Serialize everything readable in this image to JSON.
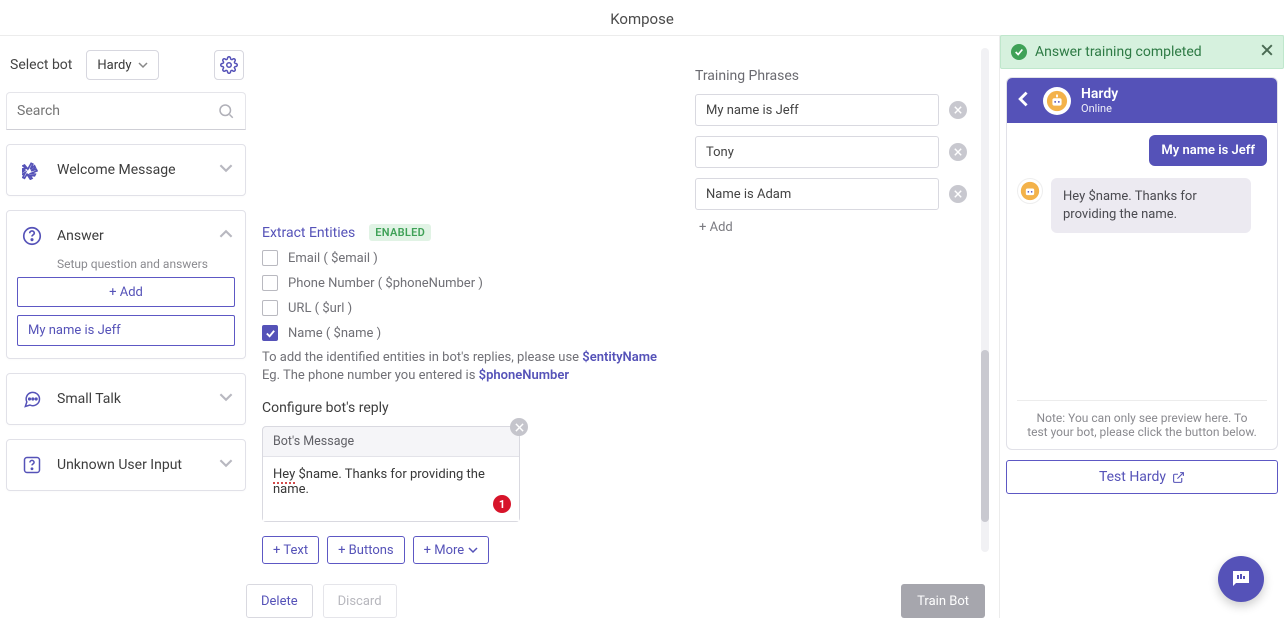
{
  "app_title": "Kompose",
  "sidebar": {
    "select_label": "Select bot",
    "selected_bot": "Hardy",
    "search_placeholder": "Search",
    "intents": {
      "welcome": {
        "title": "Welcome Message"
      },
      "answer": {
        "title": "Answer",
        "subtitle": "Setup question and answers",
        "add_label": "+ Add",
        "items": [
          "My name is Jeff"
        ]
      },
      "smalltalk": {
        "title": "Small Talk"
      },
      "unknown": {
        "title": "Unknown User Input"
      }
    }
  },
  "entities": {
    "section_title": "Extract Entities",
    "badge": "ENABLED",
    "options": [
      {
        "label": "Email ( $email )",
        "checked": false
      },
      {
        "label": "Phone Number ( $phoneNumber )",
        "checked": false
      },
      {
        "label": "URL ( $url )",
        "checked": false
      },
      {
        "label": "Name ( $name )",
        "checked": true
      }
    ],
    "hint_prefix": "To add the identified entities in bot's replies, please use ",
    "hint_var1": "$entityName",
    "hint_line2_prefix": "Eg. The phone number you entered is ",
    "hint_var2": "$phoneNumber"
  },
  "reply": {
    "section_title": "Configure bot's reply",
    "card_title": "Bot's Message",
    "message_prefix": "Hey",
    "message_rest": " $name. Thanks for providing the name.",
    "counter": "1",
    "btn_text": "+ Text",
    "btn_buttons": "+ Buttons",
    "btn_more": "+ More"
  },
  "footer": {
    "delete": "Delete",
    "discard": "Discard",
    "train": "Train Bot"
  },
  "training": {
    "title": "Training Phrases",
    "phrases": [
      "My name is Jeff",
      "Tony",
      "Name is Adam"
    ],
    "add_label": "+ Add"
  },
  "toast": {
    "text": "Answer training completed"
  },
  "chat": {
    "bot_name": "Hardy",
    "status": "Online",
    "user_msg": "My name is Jeff",
    "bot_msg": "Hey $name. Thanks for providing the name.",
    "note": "Note: You can only see preview here. To test your bot, please click the button below.",
    "test_btn": "Test Hardy"
  }
}
